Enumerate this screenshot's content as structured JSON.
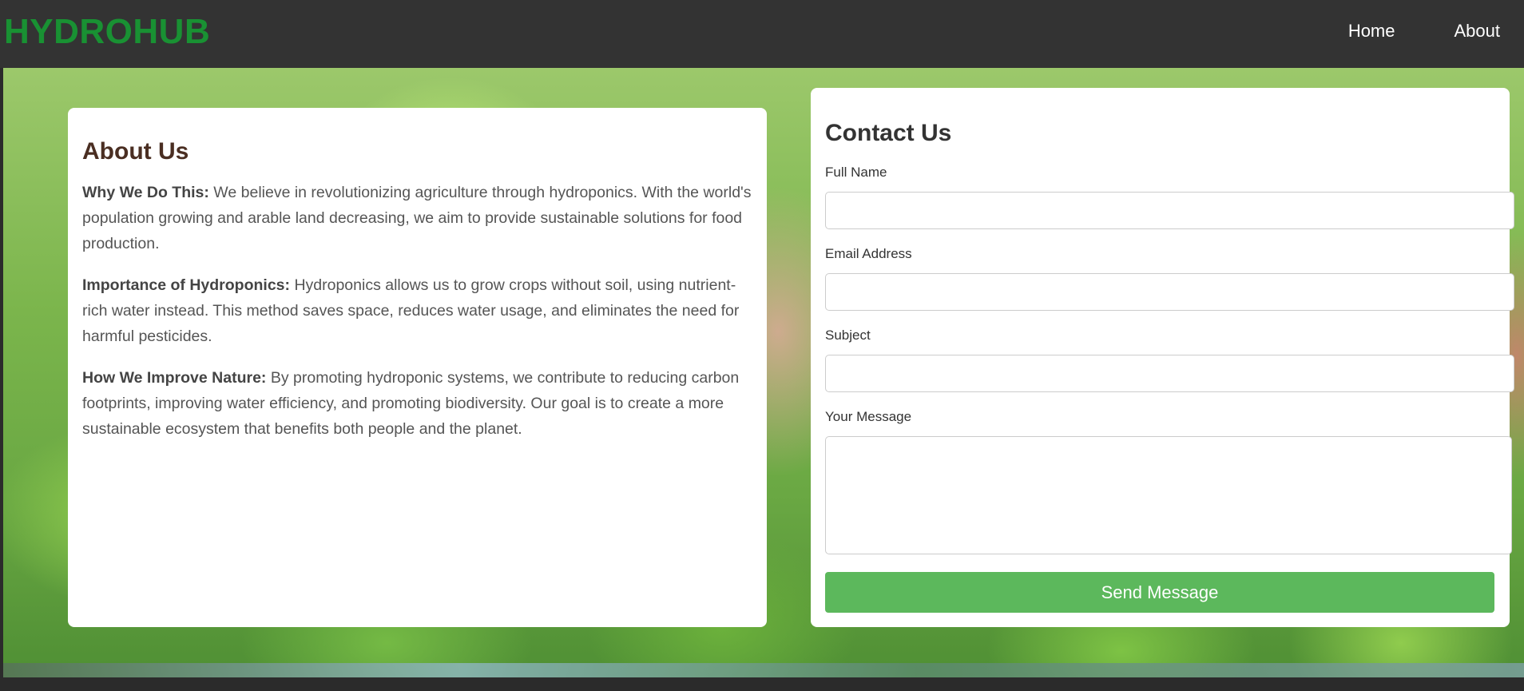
{
  "nav": {
    "brand": "HYDROHUB",
    "links": [
      "Home",
      "About"
    ]
  },
  "about": {
    "title": "About Us",
    "paragraphs": [
      {
        "label": "Why We Do This:",
        "text": " We believe in revolutionizing agriculture through hydroponics. With the world's population growing and arable land decreasing, we aim to provide sustainable solutions for food production."
      },
      {
        "label": "Importance of Hydroponics:",
        "text": " Hydroponics allows us to grow crops without soil, using nutrient-rich water instead. This method saves space, reduces water usage, and eliminates the need for harmful pesticides."
      },
      {
        "label": "How We Improve Nature:",
        "text": " By promoting hydroponic systems, we contribute to reducing carbon footprints, improving water efficiency, and promoting biodiversity. Our goal is to create a more sustainable ecosystem that benefits both people and the planet."
      }
    ]
  },
  "contact": {
    "title": "Contact Us",
    "full_name_label": "Full Name",
    "full_name_value": "",
    "email_label": "Email Address",
    "email_value": "",
    "subject_label": "Subject",
    "subject_value": "",
    "message_label": "Your Message",
    "message_value": "",
    "send_label": "Send Message"
  },
  "colors": {
    "brand": "#199133",
    "navbar": "#333333",
    "button": "#5cb85c"
  }
}
